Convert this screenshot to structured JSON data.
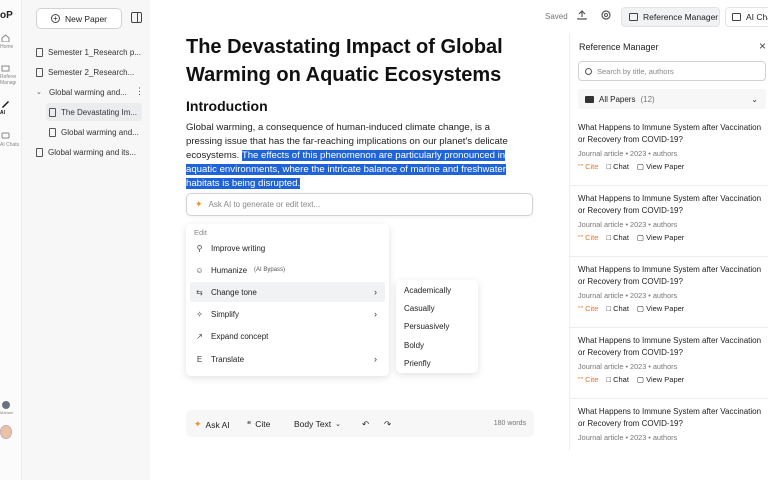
{
  "rail": {
    "logo": "oP",
    "items": [
      {
        "label": "Home"
      },
      {
        "label": "Reference Manager"
      },
      {
        "label": "AI Writer"
      },
      {
        "label": "AI Chats"
      }
    ],
    "user_label": "Mariam"
  },
  "sidebar": {
    "new_paper": "New Paper",
    "tree": [
      {
        "label": "Semester 1_Research p...",
        "type": "folder"
      },
      {
        "label": "Semester 2_Research...",
        "type": "folder"
      },
      {
        "label": "Global warming and...",
        "type": "folder-open"
      },
      {
        "label": "The Devastating Im...",
        "type": "doc",
        "active": true
      },
      {
        "label": "Global warming and...",
        "type": "doc"
      },
      {
        "label": "Global warming and its...",
        "type": "doc"
      }
    ]
  },
  "topbar": {
    "saved": "Saved",
    "reference_manager": "Reference Manager",
    "ai_chat": "AI Chat"
  },
  "editor": {
    "title": "The Devastating Impact of Global Warming on Aquatic Ecosystems",
    "heading": "Introduction",
    "para_plain": "Global warming, a consequence of human-induced climate change, is a pressing issue that has the far-reaching implications on our planet's delicate ecosystems.",
    "para_selected": "The effects of this phenomenon are particularly pronounced in aquatic environments, where the intricate balance of marine and freshwater habitats is being disrupted.",
    "ai_placeholder": "Ask AI to generate or edit text...",
    "menu": {
      "header": "Edit",
      "items": [
        {
          "label": "Improve writing",
          "icon": "wand-icon"
        },
        {
          "label": "Humanize",
          "note": "(AI Bypass)",
          "icon": "person-icon"
        },
        {
          "label": "Change tone",
          "icon": "swap-icon"
        },
        {
          "label": "Simplify",
          "icon": "sparkle-icon"
        },
        {
          "label": "Expand concept",
          "icon": "expand-icon"
        },
        {
          "label": "Translate",
          "icon": "translate-icon"
        }
      ]
    },
    "tones": [
      "Academically",
      "Casually",
      "Persuasively",
      "Boldy",
      "Prienfly"
    ],
    "bottom": {
      "ask_ai": "Ask AI",
      "cite": "Cite",
      "body_text": "Body Text",
      "word_count": "180 words"
    }
  },
  "reference_manager": {
    "title": "Reference Manager",
    "search_placeholder": "Search by title, authors",
    "folder": "All Papers",
    "count": "(12)",
    "items": [
      {
        "title1": "What Happens to Immune System after Vaccination",
        "title2": "or Recovery from COVID-19?",
        "meta": "Journal article  •  2023  •  authors"
      },
      {
        "title1": "What Happens to Immune System after Vaccination",
        "title2": "or Recovery from COVID-19?",
        "meta": "Journal article  •  2023  •  authors"
      },
      {
        "title1": "What Happens to Immune System after Vaccination",
        "title2": "or Recovery from COVID-19?",
        "meta": "Journal article  •  2023  •  authors"
      },
      {
        "title1": "What Happens to Immune System after Vaccination",
        "title2": "or Recovery from COVID-19?",
        "meta": "Journal article  •  2023  •  authors"
      },
      {
        "title1": "What Happens to Immune System after Vaccination",
        "title2": "or Recovery from COVID-19?",
        "meta": "Journal article  •  2023  •  authors"
      }
    ],
    "action_cite": "Cite",
    "action_chat": "Chat",
    "action_view": "View Paper"
  }
}
